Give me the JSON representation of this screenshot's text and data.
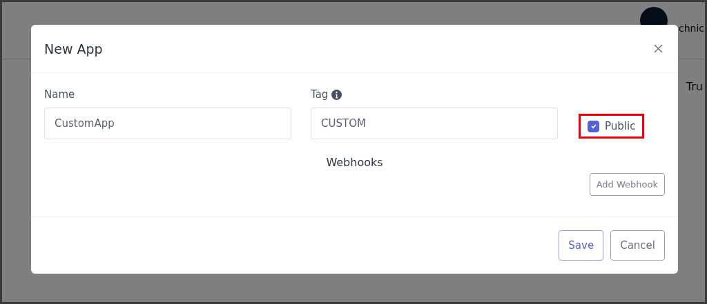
{
  "background": {
    "user_label": "chnic",
    "column_header": "Tru"
  },
  "dialog": {
    "title": "New App",
    "fields": [
      {
        "label": "Name",
        "value": "CustomApp",
        "info": false
      },
      {
        "label": "Tag",
        "value": "CUSTOM",
        "info": true
      }
    ],
    "public": {
      "label": "Public",
      "checked": true,
      "highlighted": true
    },
    "section_title": "Webhooks",
    "add_button": "Add Webhook",
    "buttons": [
      {
        "label": "Save",
        "kind": "primary"
      },
      {
        "label": "Cancel",
        "kind": "secondary"
      }
    ]
  }
}
